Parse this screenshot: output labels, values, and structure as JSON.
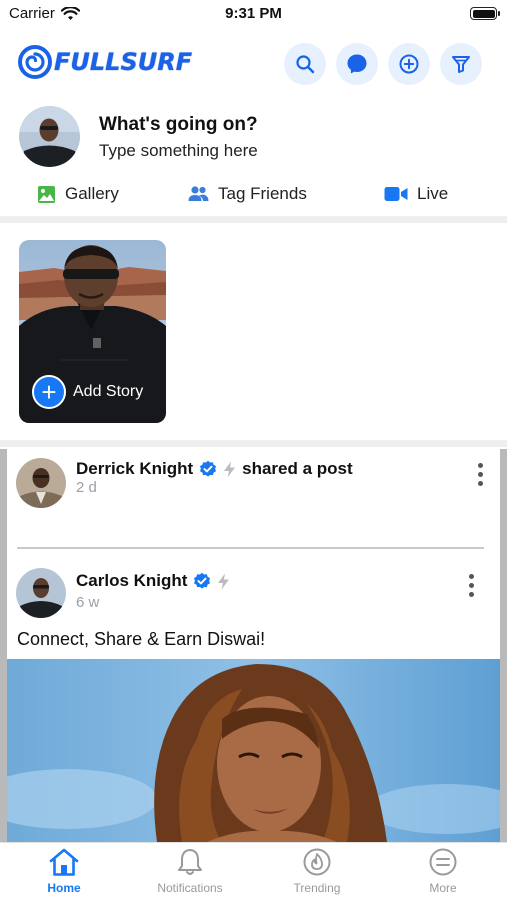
{
  "status_bar": {
    "carrier": "Carrier",
    "time": "9:31 PM"
  },
  "header": {
    "logo_text": "FULLSURF",
    "icons": [
      "search-icon",
      "messenger-icon",
      "add-circle-icon",
      "filter-icon"
    ]
  },
  "composer": {
    "title": "What's going on?",
    "placeholder": "Type something here",
    "actions": [
      {
        "label": "Gallery",
        "icon": "gallery-icon"
      },
      {
        "label": "Tag Friends",
        "icon": "tag-friends-icon"
      },
      {
        "label": "Live",
        "icon": "live-video-icon"
      }
    ]
  },
  "story": {
    "add_label": "Add Story"
  },
  "feed": {
    "posts": [
      {
        "author": "Derrick Knight",
        "action": "shared a post",
        "time": "2 d"
      },
      {
        "author": "Carlos Knight",
        "time": "6 w",
        "text": "Connect, Share & Earn Diswai!"
      }
    ]
  },
  "tabs": [
    {
      "label": "Home",
      "icon": "home-icon",
      "active": true
    },
    {
      "label": "Notifications",
      "icon": "bell-icon"
    },
    {
      "label": "Trending",
      "icon": "flame-icon"
    },
    {
      "label": "More",
      "icon": "menu-icon"
    }
  ],
  "colors": {
    "brand": "#1a63e8",
    "accent": "#1877f2",
    "inactive": "#9a9a9a",
    "verified": "#1877f2"
  }
}
